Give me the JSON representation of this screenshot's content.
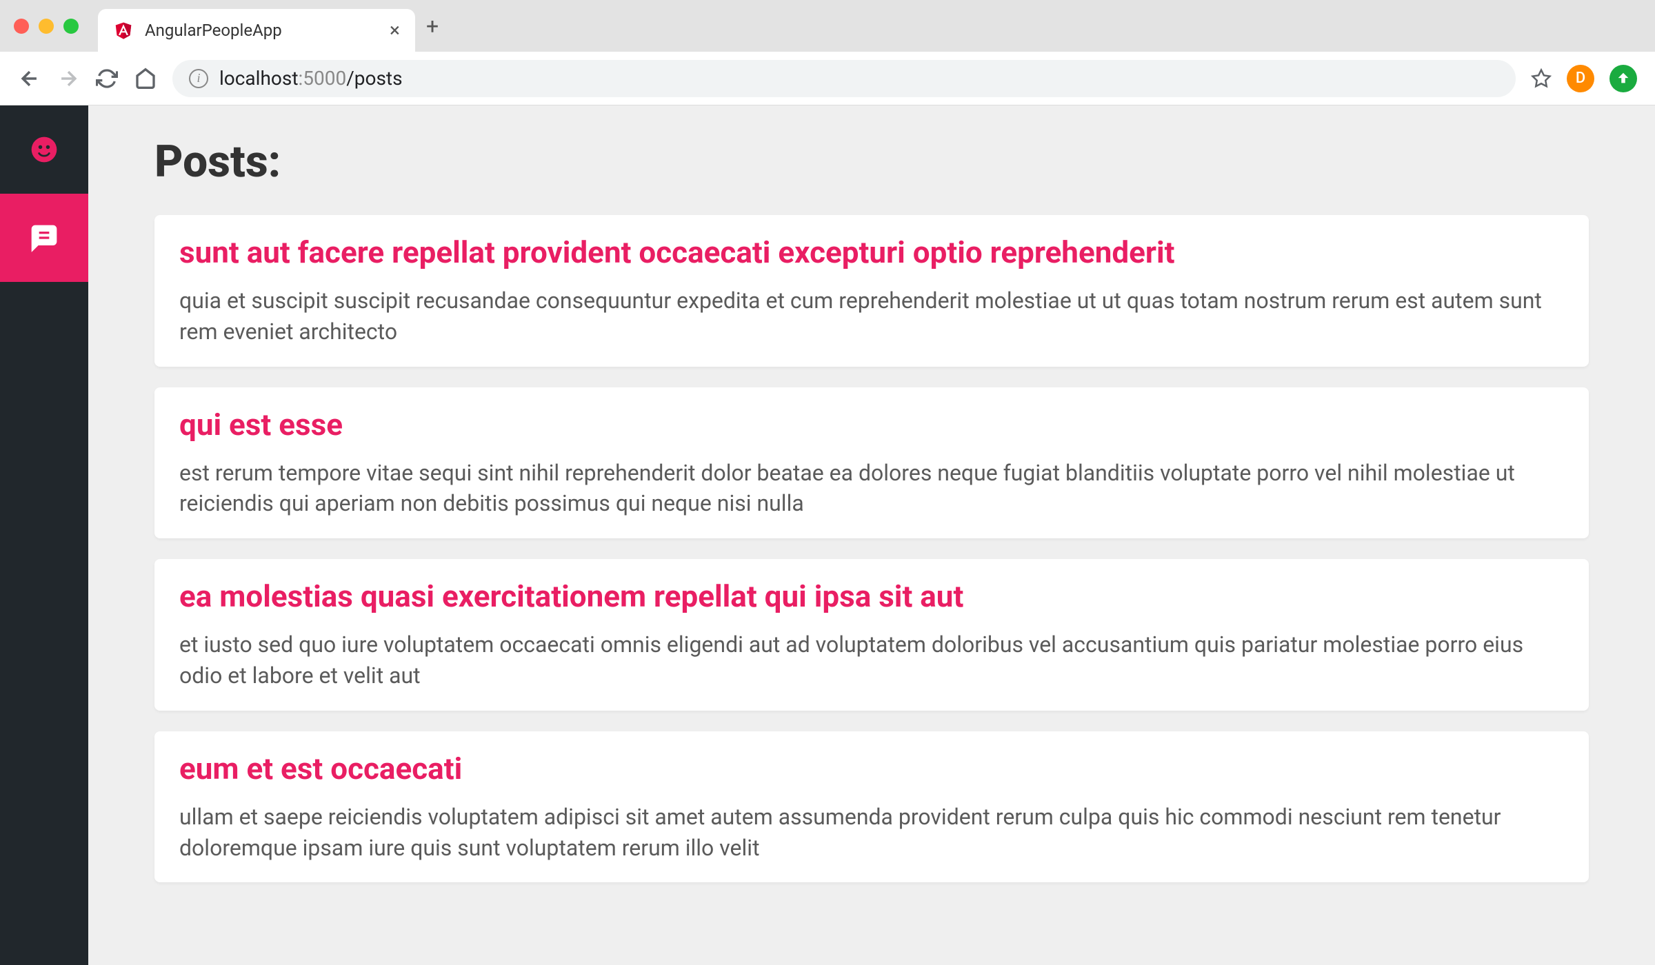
{
  "browser": {
    "tab_title": "AngularPeopleApp",
    "url_host": "localhost",
    "url_port": ":5000",
    "url_path": "/posts",
    "avatar_letter": "D"
  },
  "page": {
    "heading": "Posts:"
  },
  "posts": [
    {
      "title": "sunt aut facere repellat provident occaecati excepturi optio reprehenderit",
      "body": "quia et suscipit suscipit recusandae consequuntur expedita et cum reprehenderit molestiae ut ut quas totam nostrum rerum est autem sunt rem eveniet architecto"
    },
    {
      "title": "qui est esse",
      "body": "est rerum tempore vitae sequi sint nihil reprehenderit dolor beatae ea dolores neque fugiat blanditiis voluptate porro vel nihil molestiae ut reiciendis qui aperiam non debitis possimus qui neque nisi nulla"
    },
    {
      "title": "ea molestias quasi exercitationem repellat qui ipsa sit aut",
      "body": "et iusto sed quo iure voluptatem occaecati omnis eligendi aut ad voluptatem doloribus vel accusantium quis pariatur molestiae porro eius odio et labore et velit aut"
    },
    {
      "title": "eum et est occaecati",
      "body": "ullam et saepe reiciendis voluptatem adipisci sit amet autem assumenda provident rerum culpa quis hic commodi nesciunt rem tenetur doloremque ipsam iure quis sunt voluptatem rerum illo velit"
    }
  ]
}
